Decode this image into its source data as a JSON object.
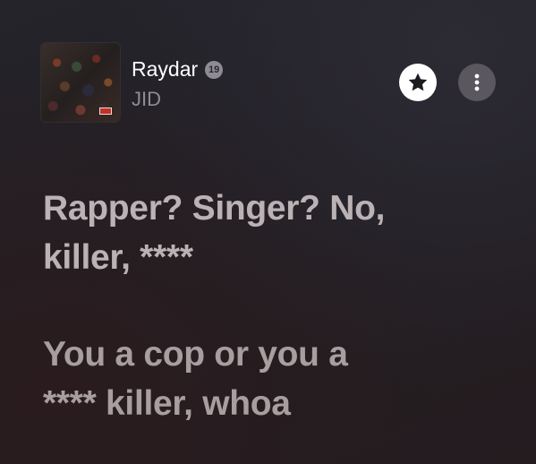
{
  "song": {
    "title": "Raydar",
    "age_rating": "19",
    "artist": "JID",
    "artwork_icon": "album-artwork"
  },
  "actions": {
    "favorite_icon": "star-icon",
    "more_icon": "more-vertical-icon"
  },
  "lyrics": {
    "lines": [
      "Rapper? Singer? No,",
      "killer, ****",
      "You a cop or you a",
      "**** killer, whoa"
    ]
  },
  "colors": {
    "title": "#ffffff",
    "artist": "#8f8c93",
    "lyrics": "#bab2b4",
    "fav_button_bg": "#ffffff",
    "more_button_bg": "#5a575e"
  }
}
